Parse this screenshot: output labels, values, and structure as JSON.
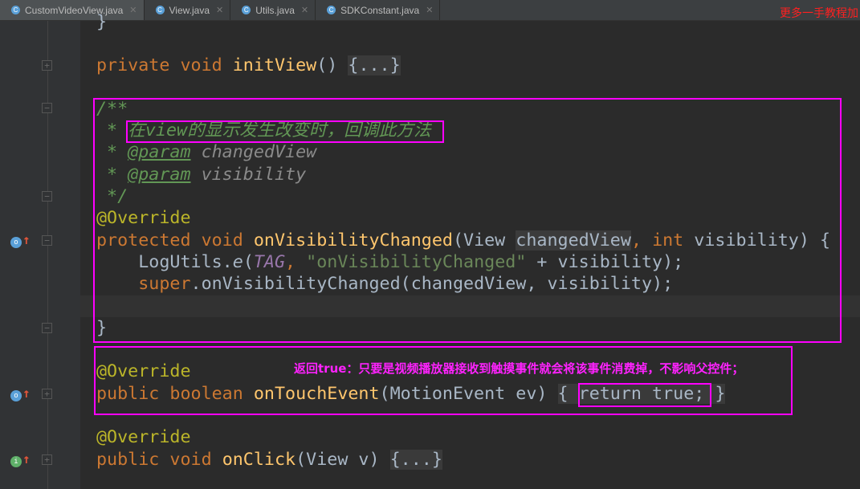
{
  "tabs": [
    {
      "label": "CustomVideoView.java",
      "active": true
    },
    {
      "label": "View.java"
    },
    {
      "label": "Utils.java"
    },
    {
      "label": "SDKConstant.java"
    }
  ],
  "watermark": "更多一手教程加",
  "code": {
    "l0": "}",
    "l2a": "private void ",
    "l2b": "initView",
    "l2c": "() ",
    "l2d": "{...}",
    "l4": "/**",
    "l5a": " * ",
    "l5b": "在view的显示发生改变时，回调此方法",
    "l6a": " * ",
    "l6b": "@param",
    "l6c": " changedView",
    "l7a": " * ",
    "l7b": "@param",
    "l7c": " visibility",
    "l8": " */",
    "l9": "@Override",
    "l10a": "protected void ",
    "l10b": "onVisibilityChanged",
    "l10c": "(View ",
    "l10d": "changedView",
    "l10e": ", ",
    "l10f": "int ",
    "l10g": "visibility) {",
    "l11a": "    LogUtils.",
    "l11b": "e",
    "l11c": "(",
    "l11d": "TAG",
    "l11e": ", ",
    "l11f": "\"onVisibilityChanged\"",
    "l11g": " + visibility);",
    "l12a": "    ",
    "l12b": "super",
    "l12c": ".onVisibilityChanged(changedView, visibility);",
    "l14": "}",
    "l16": "@Override",
    "l17a": "public boolean ",
    "l17b": "onTouchEvent",
    "l17c": "(MotionEvent ev) ",
    "l17d": "{ ",
    "l17e": "return true;",
    "l17f": " }",
    "l19": "@Override",
    "l20a": "public void ",
    "l20b": "onClick",
    "l20c": "(View v) ",
    "l20d": "{...}"
  },
  "annotation": "返回true：只要是视频播放器接收到触摸事件就会将该事件消费掉，不影响父控件；"
}
